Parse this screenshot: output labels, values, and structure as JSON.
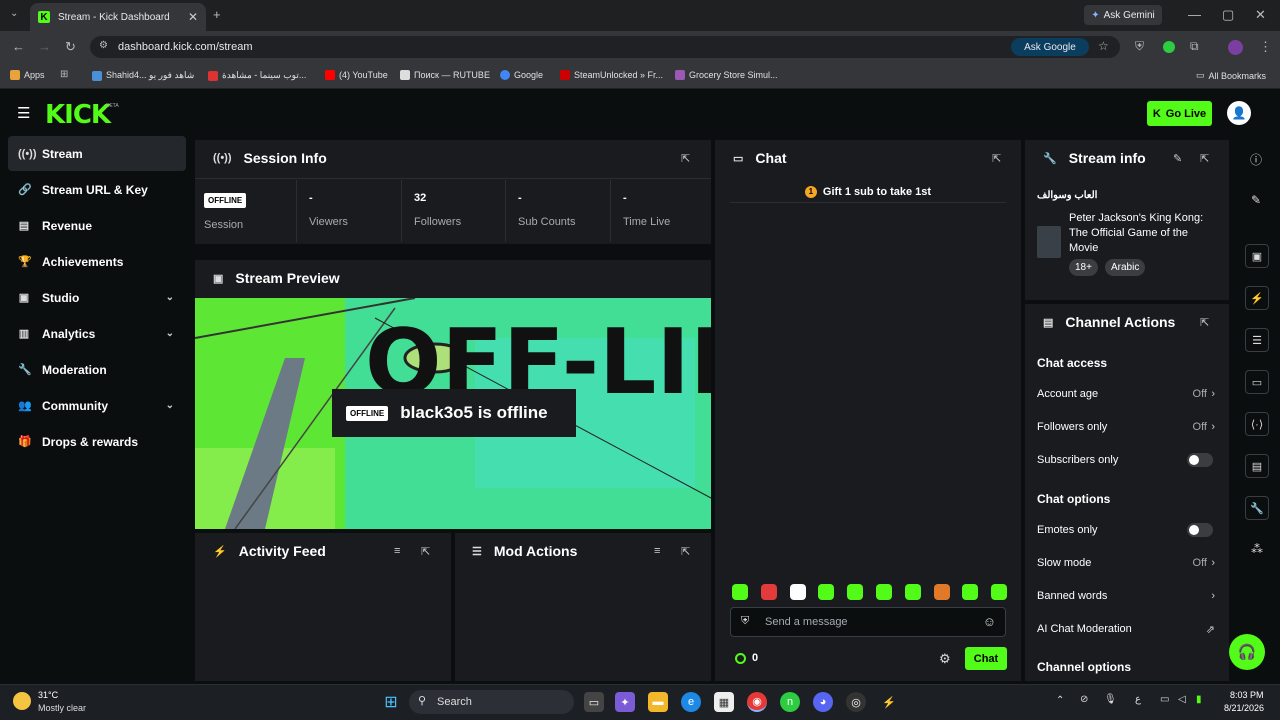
{
  "browser": {
    "tab_title": "Stream - Kick Dashboard",
    "tab_close": "✕",
    "new_tab": "+",
    "ask_gemini": "Ask Gemini",
    "url": "dashboard.kick.com/stream",
    "ask_google": "Ask Google",
    "bookmarks": [
      {
        "label": "Apps",
        "color": "#e8a33d"
      },
      {
        "label": "Shahid4... شاهد فور يو",
        "color": "#4a90d9"
      },
      {
        "label": "توب سينما - مشاهدة...",
        "color": "#d33"
      },
      {
        "label": "(4) YouTube",
        "color": "#f00"
      },
      {
        "label": "Поиск — RUTUBE",
        "color": "#222"
      },
      {
        "label": "Google",
        "color": "#4285f4"
      },
      {
        "label": "SteamUnlocked » Fr...",
        "color": "#c00"
      },
      {
        "label": "Grocery Store Simul...",
        "color": "#9b59b6"
      }
    ],
    "all_bookmarks": "All Bookmarks"
  },
  "header": {
    "logo": "KICK",
    "beta": "BETA",
    "go_live": "Go Live"
  },
  "sidebar": {
    "items": [
      {
        "label": "Stream",
        "icon": "stream-icon",
        "glyph": "((•))"
      },
      {
        "label": "Stream URL & Key",
        "icon": "link-icon",
        "glyph": "🔗"
      },
      {
        "label": "Revenue",
        "icon": "revenue-icon",
        "glyph": "▤"
      },
      {
        "label": "Achievements",
        "icon": "trophy-icon",
        "glyph": "🏆"
      },
      {
        "label": "Studio",
        "icon": "studio-icon",
        "glyph": "▣"
      },
      {
        "label": "Analytics",
        "icon": "analytics-icon",
        "glyph": "▥"
      },
      {
        "label": "Moderation",
        "icon": "wrench-icon",
        "glyph": "🔧"
      },
      {
        "label": "Community",
        "icon": "community-icon",
        "glyph": "👥"
      },
      {
        "label": "Drops & rewards",
        "icon": "gift-icon",
        "glyph": "🎁"
      }
    ],
    "chevron": "⌄"
  },
  "session": {
    "title": "Session Info",
    "status_badge": "OFFLINE",
    "session_label": "Session",
    "stats": [
      {
        "value": "-",
        "label": "Viewers"
      },
      {
        "value": "32",
        "label": "Followers"
      },
      {
        "value": "-",
        "label": "Sub Counts"
      },
      {
        "value": "-",
        "label": "Time Live"
      }
    ]
  },
  "preview": {
    "title": "Stream Preview",
    "badge": "OFFLINE",
    "message": "black3o5 is offline",
    "bg_text": "OFF-LINE"
  },
  "activity": {
    "title": "Activity Feed"
  },
  "mod_actions": {
    "title": "Mod Actions"
  },
  "chat": {
    "title": "Chat",
    "pinned": "Gift 1 sub to take 1st",
    "placeholder": "Send a message",
    "points": "0",
    "send": "Chat",
    "emote_colors": [
      "#53fc18",
      "#e23b3b",
      "#ffffff",
      "#53fc18",
      "#53fc18",
      "#53fc18",
      "#53fc18",
      "#e07a2a",
      "#53fc18",
      "#53fc18"
    ]
  },
  "stream_info": {
    "title": "Stream info",
    "stream_title": "العاب وسوالف",
    "game": "Peter Jackson's King Kong: The Official Game of the Movie",
    "tags": [
      "18+",
      "Arabic"
    ]
  },
  "channel_actions": {
    "title": "Channel Actions",
    "chat_access": "Chat access",
    "rows": [
      {
        "label": "Account age",
        "value": "Off"
      },
      {
        "label": "Followers only",
        "value": "Off"
      }
    ],
    "subscribers_only": "Subscribers only",
    "chat_options": "Chat options",
    "emotes_only": "Emotes only",
    "slow_mode": "Slow mode",
    "slow_mode_value": "Off",
    "banned_words": "Banned words",
    "ai_moderation": "AI Chat Moderation",
    "channel_options": "Channel options"
  },
  "taskbar": {
    "weather_temp": "31°C",
    "weather_desc": "Mostly clear",
    "search": "Search",
    "time": "8:03 PM",
    "date": "8/21/2026",
    "lang": "ع"
  }
}
